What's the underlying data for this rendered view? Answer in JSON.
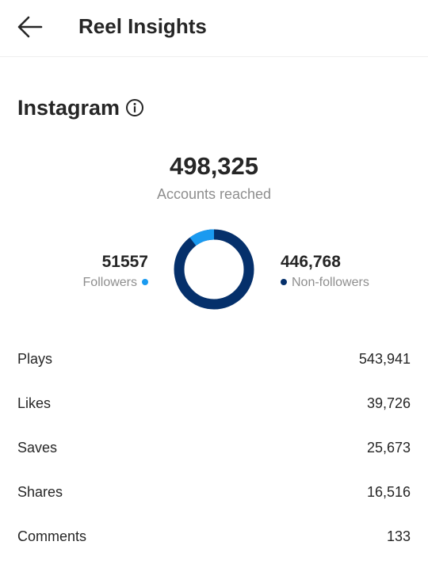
{
  "header": {
    "title": "Reel Insights",
    "back_icon": "arrow-left-icon"
  },
  "section": {
    "title": "Instagram",
    "info_icon": "info-circle-icon"
  },
  "reach": {
    "value": "498,325",
    "label": "Accounts reached"
  },
  "breakdown": {
    "followers": {
      "value": "51557",
      "label": "Followers",
      "count": 51557,
      "color": "#1a9af0"
    },
    "non_followers": {
      "value": "446,768",
      "label": "Non-followers",
      "count": 446768,
      "color": "#05306b"
    }
  },
  "metrics": [
    {
      "label": "Plays",
      "value": "543,941"
    },
    {
      "label": "Likes",
      "value": "39,726"
    },
    {
      "label": "Saves",
      "value": "25,673"
    },
    {
      "label": "Shares",
      "value": "16,516"
    },
    {
      "label": "Comments",
      "value": "133"
    }
  ]
}
